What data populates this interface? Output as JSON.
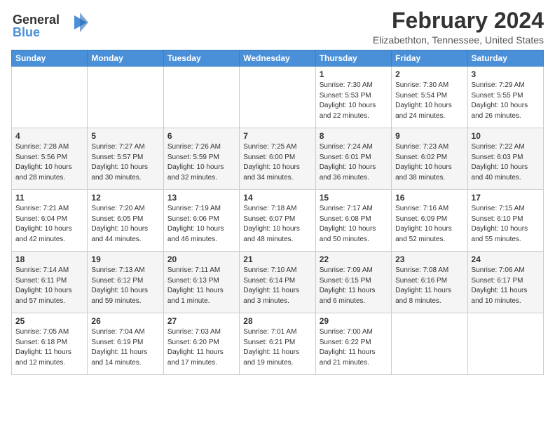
{
  "logo": {
    "line1": "General",
    "line2": "Blue"
  },
  "title": "February 2024",
  "location": "Elizabethton, Tennessee, United States",
  "days_header": [
    "Sunday",
    "Monday",
    "Tuesday",
    "Wednesday",
    "Thursday",
    "Friday",
    "Saturday"
  ],
  "weeks": [
    [
      {
        "day": "",
        "info": ""
      },
      {
        "day": "",
        "info": ""
      },
      {
        "day": "",
        "info": ""
      },
      {
        "day": "",
        "info": ""
      },
      {
        "day": "1",
        "info": "Sunrise: 7:30 AM\nSunset: 5:53 PM\nDaylight: 10 hours\nand 22 minutes."
      },
      {
        "day": "2",
        "info": "Sunrise: 7:30 AM\nSunset: 5:54 PM\nDaylight: 10 hours\nand 24 minutes."
      },
      {
        "day": "3",
        "info": "Sunrise: 7:29 AM\nSunset: 5:55 PM\nDaylight: 10 hours\nand 26 minutes."
      }
    ],
    [
      {
        "day": "4",
        "info": "Sunrise: 7:28 AM\nSunset: 5:56 PM\nDaylight: 10 hours\nand 28 minutes."
      },
      {
        "day": "5",
        "info": "Sunrise: 7:27 AM\nSunset: 5:57 PM\nDaylight: 10 hours\nand 30 minutes."
      },
      {
        "day": "6",
        "info": "Sunrise: 7:26 AM\nSunset: 5:59 PM\nDaylight: 10 hours\nand 32 minutes."
      },
      {
        "day": "7",
        "info": "Sunrise: 7:25 AM\nSunset: 6:00 PM\nDaylight: 10 hours\nand 34 minutes."
      },
      {
        "day": "8",
        "info": "Sunrise: 7:24 AM\nSunset: 6:01 PM\nDaylight: 10 hours\nand 36 minutes."
      },
      {
        "day": "9",
        "info": "Sunrise: 7:23 AM\nSunset: 6:02 PM\nDaylight: 10 hours\nand 38 minutes."
      },
      {
        "day": "10",
        "info": "Sunrise: 7:22 AM\nSunset: 6:03 PM\nDaylight: 10 hours\nand 40 minutes."
      }
    ],
    [
      {
        "day": "11",
        "info": "Sunrise: 7:21 AM\nSunset: 6:04 PM\nDaylight: 10 hours\nand 42 minutes."
      },
      {
        "day": "12",
        "info": "Sunrise: 7:20 AM\nSunset: 6:05 PM\nDaylight: 10 hours\nand 44 minutes."
      },
      {
        "day": "13",
        "info": "Sunrise: 7:19 AM\nSunset: 6:06 PM\nDaylight: 10 hours\nand 46 minutes."
      },
      {
        "day": "14",
        "info": "Sunrise: 7:18 AM\nSunset: 6:07 PM\nDaylight: 10 hours\nand 48 minutes."
      },
      {
        "day": "15",
        "info": "Sunrise: 7:17 AM\nSunset: 6:08 PM\nDaylight: 10 hours\nand 50 minutes."
      },
      {
        "day": "16",
        "info": "Sunrise: 7:16 AM\nSunset: 6:09 PM\nDaylight: 10 hours\nand 52 minutes."
      },
      {
        "day": "17",
        "info": "Sunrise: 7:15 AM\nSunset: 6:10 PM\nDaylight: 10 hours\nand 55 minutes."
      }
    ],
    [
      {
        "day": "18",
        "info": "Sunrise: 7:14 AM\nSunset: 6:11 PM\nDaylight: 10 hours\nand 57 minutes."
      },
      {
        "day": "19",
        "info": "Sunrise: 7:13 AM\nSunset: 6:12 PM\nDaylight: 10 hours\nand 59 minutes."
      },
      {
        "day": "20",
        "info": "Sunrise: 7:11 AM\nSunset: 6:13 PM\nDaylight: 11 hours\nand 1 minute."
      },
      {
        "day": "21",
        "info": "Sunrise: 7:10 AM\nSunset: 6:14 PM\nDaylight: 11 hours\nand 3 minutes."
      },
      {
        "day": "22",
        "info": "Sunrise: 7:09 AM\nSunset: 6:15 PM\nDaylight: 11 hours\nand 6 minutes."
      },
      {
        "day": "23",
        "info": "Sunrise: 7:08 AM\nSunset: 6:16 PM\nDaylight: 11 hours\nand 8 minutes."
      },
      {
        "day": "24",
        "info": "Sunrise: 7:06 AM\nSunset: 6:17 PM\nDaylight: 11 hours\nand 10 minutes."
      }
    ],
    [
      {
        "day": "25",
        "info": "Sunrise: 7:05 AM\nSunset: 6:18 PM\nDaylight: 11 hours\nand 12 minutes."
      },
      {
        "day": "26",
        "info": "Sunrise: 7:04 AM\nSunset: 6:19 PM\nDaylight: 11 hours\nand 14 minutes."
      },
      {
        "day": "27",
        "info": "Sunrise: 7:03 AM\nSunset: 6:20 PM\nDaylight: 11 hours\nand 17 minutes."
      },
      {
        "day": "28",
        "info": "Sunrise: 7:01 AM\nSunset: 6:21 PM\nDaylight: 11 hours\nand 19 minutes."
      },
      {
        "day": "29",
        "info": "Sunrise: 7:00 AM\nSunset: 6:22 PM\nDaylight: 11 hours\nand 21 minutes."
      },
      {
        "day": "",
        "info": ""
      },
      {
        "day": "",
        "info": ""
      }
    ]
  ]
}
